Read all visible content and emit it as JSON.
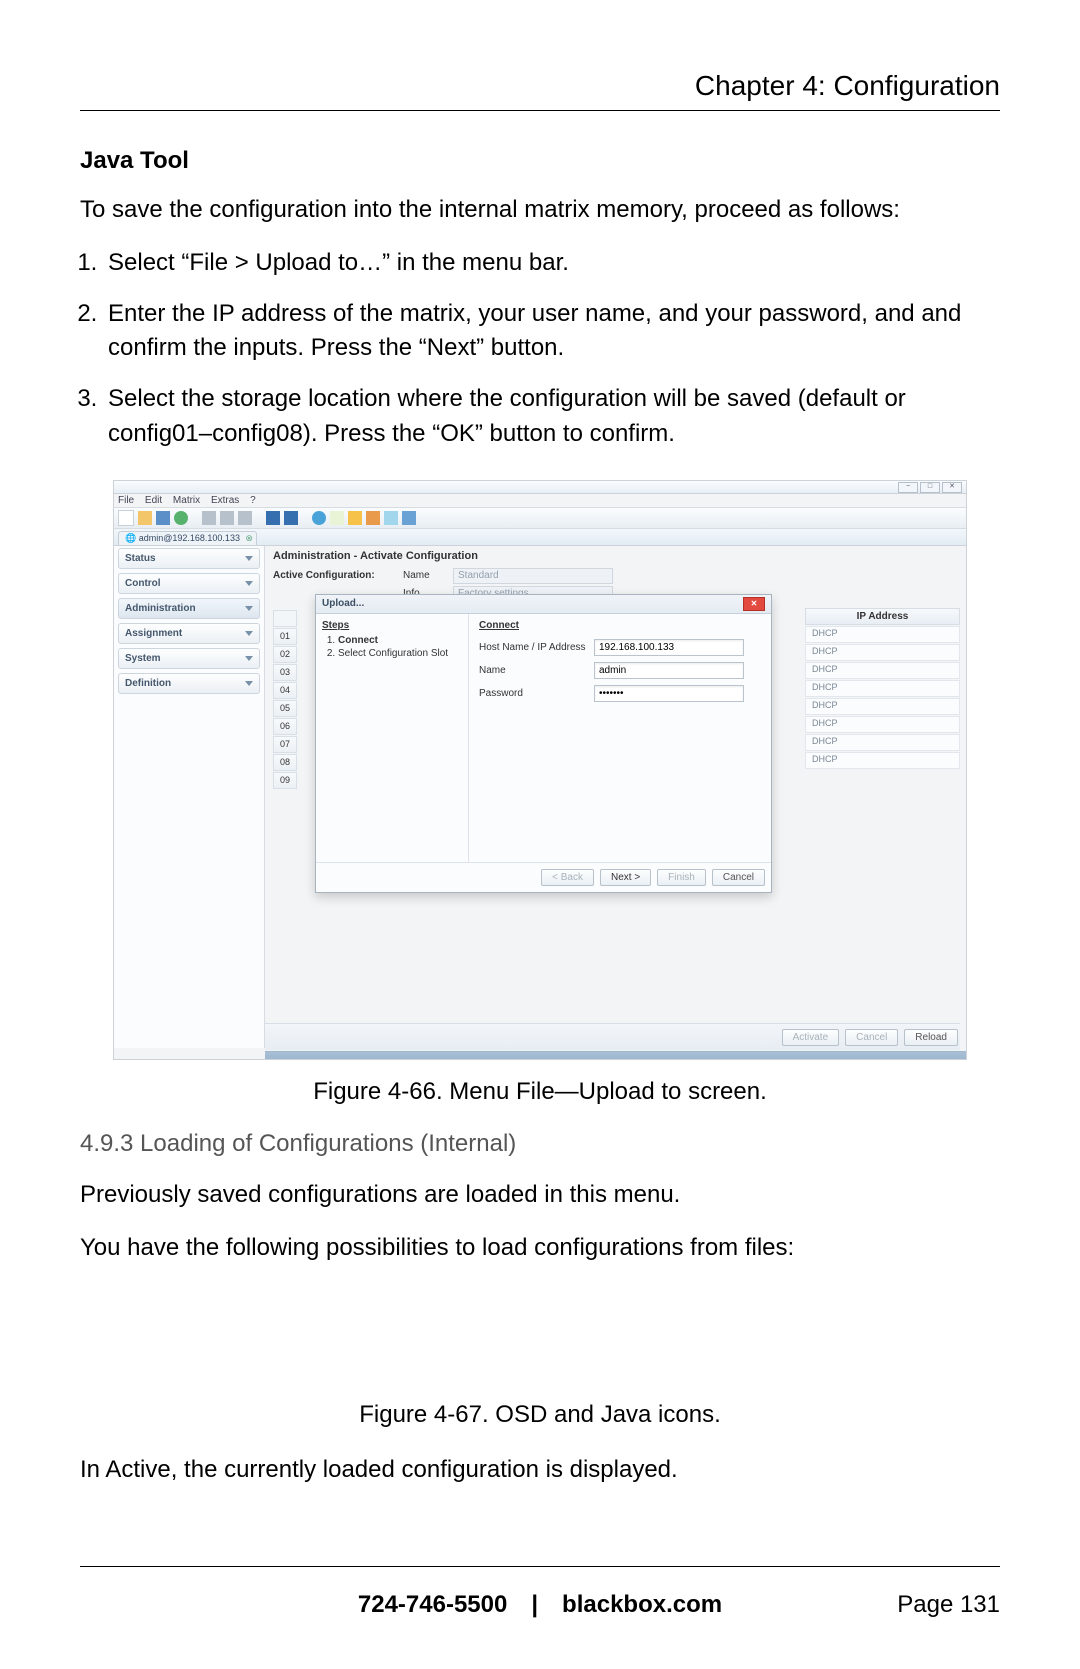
{
  "chapter_title": "Chapter 4: Configuration",
  "heading_java_tool": "Java Tool",
  "intro_save": "To save the configuration into the internal matrix memory, proceed as follows:",
  "steps": [
    "Select “File > Upload to…” in the menu bar.",
    "Enter the IP address of the matrix, your user name, and your password, and and confirm the inputs. Press the “Next” button.",
    "Select the storage location where the configuration will be saved (default or config01–config08). Press the “OK” button to confirm."
  ],
  "fig66_caption": "Figure 4-66. Menu File—Upload to screen.",
  "subsection_493": "4.9.3 Loading of Configurations (Internal)",
  "loading_p1": "Previously saved configurations are loaded in this menu.",
  "loading_p2": "You have the following possibilities to load configurations from files:",
  "fig67_caption": "Figure 4-67. OSD and Java icons.",
  "active_line": "In Active, the currently loaded configuration is displayed.",
  "footer_center": "724-746-5500 | blackbox.com",
  "footer_right": "Page 131",
  "screenshot": {
    "win_buttons": [
      "−",
      "□",
      "✕"
    ],
    "menu": {
      "file": "File",
      "edit": "Edit",
      "matrix": "Matrix",
      "extras": "Extras",
      "help": "?"
    },
    "tab_label": "admin@192.168.100.133",
    "sidebar": {
      "items": [
        "Status",
        "Control",
        "Administration",
        "Assignment",
        "System",
        "Definition"
      ]
    },
    "main": {
      "title": "Administration - Activate Configuration",
      "active_cfg_label": "Active Configuration:",
      "name_label": "Name",
      "name_value": "Standard",
      "info_label": "Info",
      "info_value": "Factory settings",
      "row_numbers": [
        "01",
        "02",
        "03",
        "04",
        "05",
        "06",
        "07",
        "08",
        "09"
      ],
      "ip_header": "IP Address",
      "ip_rows": [
        "DHCP",
        "DHCP",
        "DHCP",
        "DHCP",
        "DHCP",
        "DHCP",
        "DHCP",
        "DHCP"
      ],
      "footer_buttons": {
        "activate": "Activate",
        "cancel": "Cancel",
        "reload": "Reload"
      }
    },
    "dialog": {
      "title": "Upload...",
      "steps_header": "Steps",
      "steps": [
        "Connect",
        "Select Configuration Slot"
      ],
      "connect_header": "Connect",
      "host_label": "Host Name / IP Address",
      "host_value": "192.168.100.133",
      "name_label": "Name",
      "name_value": "admin",
      "password_label": "Password",
      "password_value": "•••••••",
      "buttons": {
        "back": "< Back",
        "next": "Next >",
        "finish": "Finish",
        "cancel": "Cancel"
      }
    }
  }
}
